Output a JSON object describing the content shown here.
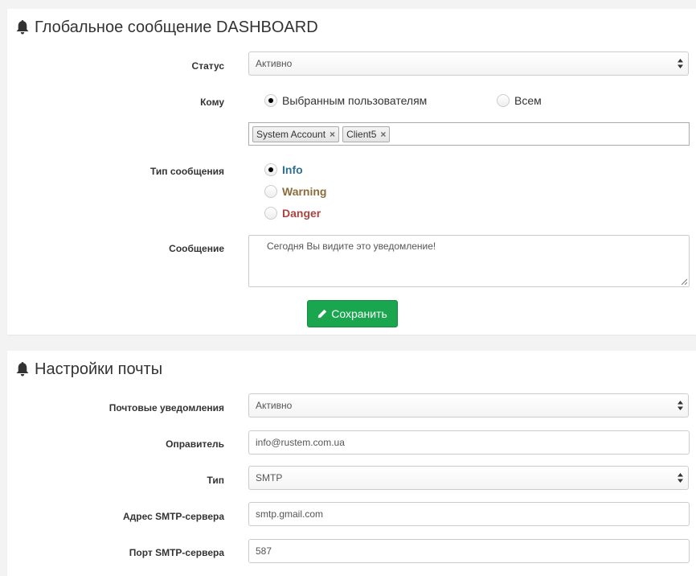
{
  "global_message": {
    "title": "Глобальное сообщение DASHBOARD",
    "status_label": "Статус",
    "status_value": "Активно",
    "to_label": "Кому",
    "to_options": [
      "Выбранным пользователям",
      "Всем"
    ],
    "to_selected": "Выбранным пользователям",
    "selected_users": [
      "System Account",
      "Client5"
    ],
    "tag_remove_symbol": "×",
    "type_label": "Тип сообщения",
    "types": [
      {
        "label": "Info",
        "color": "#31708f",
        "checked": true
      },
      {
        "label": "Warning",
        "color": "#8a6d3b",
        "checked": false
      },
      {
        "label": "Danger",
        "color": "#a94442",
        "checked": false
      }
    ],
    "message_label": "Сообщение",
    "message_value": "Сегодня Вы видите это уведомление!",
    "save_label": "Сохранить"
  },
  "mail_settings": {
    "title": "Настройки почты",
    "notifications_label": "Почтовые уведомления",
    "notifications_value": "Активно",
    "sender_label": "Оправитель",
    "sender_value": "info@rustem.com.ua",
    "type_label": "Тип",
    "type_value": "SMTP",
    "smtp_host_label": "Адрес SMTP-сервера",
    "smtp_host_value": "smtp.gmail.com",
    "smtp_port_label": "Порт SMTP-сервера",
    "smtp_port_value": "587"
  },
  "colors": {
    "save_button": "#1aa64f",
    "info": "#31708f",
    "warning": "#8a6d3b",
    "danger": "#a94442"
  },
  "icons": [
    "bell-icon",
    "select-arrows-icon",
    "tag-remove-icon",
    "pencil-icon",
    "resize-handle-icon"
  ]
}
